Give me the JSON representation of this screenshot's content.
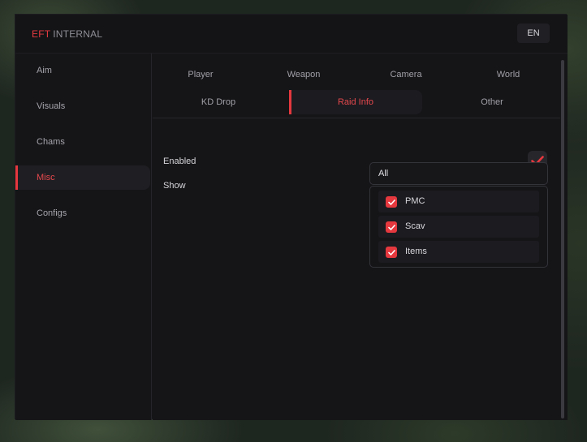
{
  "app": {
    "brand_accent": "EFT",
    "brand_rest": "INTERNAL",
    "language_button": "EN"
  },
  "sidebar": {
    "items": [
      {
        "label": "Aim",
        "active": false
      },
      {
        "label": "Visuals",
        "active": false
      },
      {
        "label": "Chams",
        "active": false
      },
      {
        "label": "Misc",
        "active": true
      },
      {
        "label": "Configs",
        "active": false
      }
    ]
  },
  "tabs": {
    "row1": [
      "Player",
      "Weapon",
      "Camera",
      "World"
    ],
    "row2": [
      "KD Drop",
      "Raid Info",
      "Other"
    ],
    "active": "Raid Info"
  },
  "settings": {
    "enabled_label": "Enabled",
    "enabled_checked": true,
    "show_label": "Show",
    "show_value": "All",
    "show_options": [
      {
        "label": "PMC",
        "checked": true
      },
      {
        "label": "Scav",
        "checked": true
      },
      {
        "label": "Items",
        "checked": true
      }
    ]
  },
  "colors": {
    "accent": "#e5383e",
    "background": "#151518",
    "text": "#d6d6da",
    "muted_text": "#a0a0a7"
  }
}
